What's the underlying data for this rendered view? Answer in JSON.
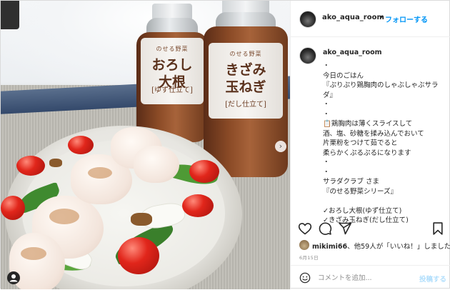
{
  "header": {
    "username": "ako_aqua_room",
    "separator": "•",
    "follow_label": "フォローする"
  },
  "caption": {
    "username": "ako_aqua_room",
    "text": "・\n今日のごはん\n『ぷりぷり鶏胸肉のしゃぶしゃぶサラダ』\n・\n・\n📋鶏胸肉は薄くスライスして\n酒、塩、砂糖を揉み込んでおいて\n片栗粉をつけて茹でると\n柔らかくぷるぷるになります\n・\n・\nサラダクラブ さま\n『のせる野菜シリーズ』\n\n✓おろし大根(ゆず仕立て)\n✓きざみ玉ねぎ(だし仕立て)\n\nのせる野菜『おろし大根』をかけて"
  },
  "photo": {
    "bottle_left": {
      "tag": "のせる野菜",
      "name_line1": "おろし",
      "name_line2": "大根",
      "sub": "[ゆず仕立て]"
    },
    "bottle_right": {
      "tag": "のせる野菜",
      "name_line1": "きざみ",
      "name_line2": "玉ねぎ",
      "sub": "[だし仕立て]"
    },
    "next_glyph": "›"
  },
  "actions": {
    "like_icon": "heart-icon",
    "comment_icon": "comment-icon",
    "share_icon": "share-icon",
    "save_icon": "bookmark-icon"
  },
  "likes": {
    "user": "mikimi66",
    "text": "、他59人が「いいね！」しました"
  },
  "date": "6月15日",
  "comment": {
    "placeholder": "コメントを追加...",
    "post_label": "投稿する"
  },
  "colors": {
    "accent": "#0095f6",
    "post_disabled": "#b2dffc",
    "text": "#262626",
    "muted": "#8e8e8e"
  }
}
